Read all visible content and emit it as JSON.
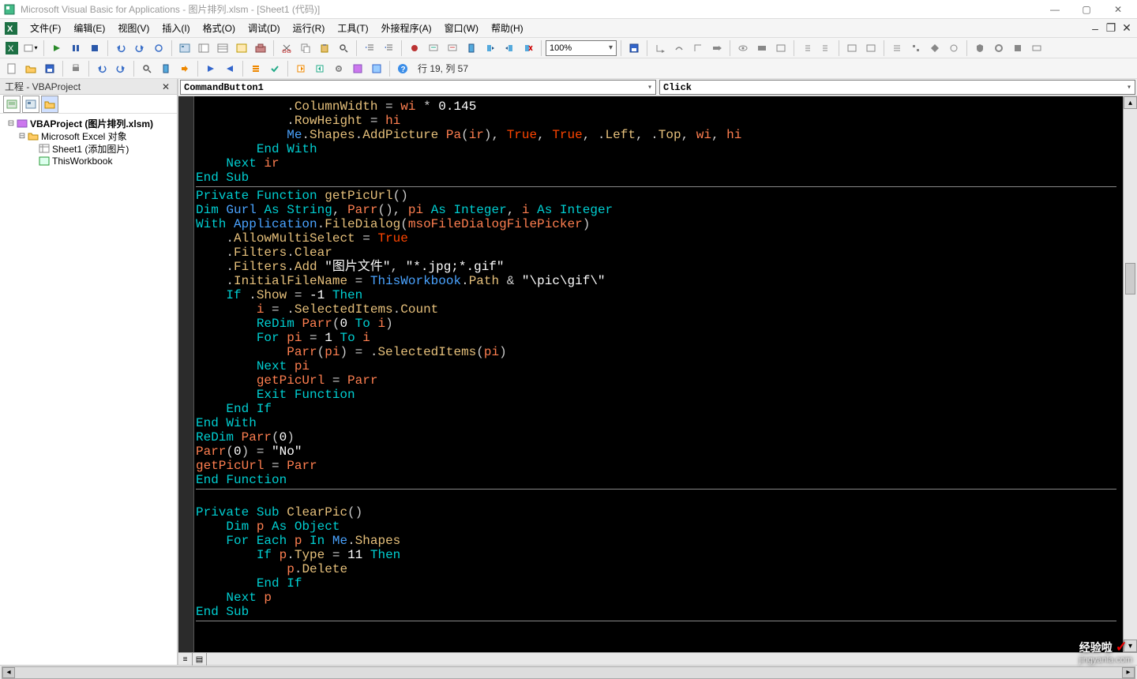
{
  "titlebar": {
    "text": "Microsoft Visual Basic for Applications - 图片排列.xlsm - [Sheet1 (代码)]"
  },
  "menus": {
    "file": "文件(F)",
    "edit": "编辑(E)",
    "view": "视图(V)",
    "insert": "插入(I)",
    "format": "格式(O)",
    "debug": "调试(D)",
    "run": "运行(R)",
    "tools": "工具(T)",
    "addins": "外接程序(A)",
    "window": "窗口(W)",
    "help": "帮助(H)"
  },
  "toolbar": {
    "zoom": "100%",
    "cursor_pos": "行 19, 列 57"
  },
  "sidebar": {
    "title": "工程 - VBAProject",
    "tree": {
      "project": "VBAProject (图片排列.xlsm)",
      "folder": "Microsoft Excel 对象",
      "sheet1": "Sheet1 (添加图片)",
      "thiswb": "ThisWorkbook"
    }
  },
  "combos": {
    "object": "CommandButton1",
    "proc": "Click"
  },
  "code": {
    "l01a": "            .ColumnWidth = wi * 0.145",
    "l02a": "            .RowHeight = hi",
    "l03a": "            Me.Shapes.AddPicture Pa(ir), True, True, .Left, .Top, wi, hi",
    "l04a": "        End With",
    "l05a": "    Next ir",
    "l06a": "End Sub",
    "l07a": "Private Function getPicUrl()",
    "l08a": "Dim Gurl As String, Parr(), pi As Integer, i As Integer",
    "l09a": "With Application.FileDialog(msoFileDialogFilePicker)",
    "l10a": "    .AllowMultiSelect = True",
    "l11a": "    .Filters.Clear",
    "l12a": "    .Filters.Add \"图片文件\", \"*.jpg;*.gif\"",
    "l13a": "    .InitialFileName = ThisWorkbook.Path & \"\\pic\\gif\\\"",
    "l14a": "    If .Show = -1 Then",
    "l15a": "        i = .SelectedItems.Count",
    "l16a": "        ReDim Parr(0 To i)",
    "l17a": "        For pi = 1 To i",
    "l18a": "            Parr(pi) = .SelectedItems(pi)",
    "l19a": "        Next pi",
    "l20a": "        getPicUrl = Parr",
    "l21a": "        Exit Function",
    "l22a": "    End If",
    "l23a": "End With",
    "l24a": "ReDim Parr(0)",
    "l25a": "Parr(0) = \"No\"",
    "l26a": "getPicUrl = Parr",
    "l27a": "End Function",
    "l28a": "",
    "l29a": "Private Sub ClearPic()",
    "l30a": "    Dim p As Object",
    "l31a": "    For Each p In Me.Shapes",
    "l32a": "        If p.Type = 11 Then",
    "l33a": "            p.Delete",
    "l34a": "        End If",
    "l35a": "    Next p",
    "l36a": "End Sub"
  },
  "watermark": {
    "main": "经验啦 ",
    "check": "✓",
    "sub": "jingyanla.com"
  }
}
